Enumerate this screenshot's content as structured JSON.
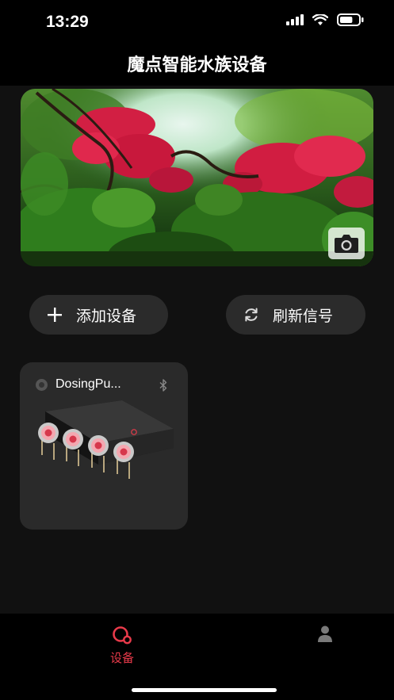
{
  "status_bar": {
    "time": "13:29",
    "battery_level": 0.7
  },
  "header": {
    "title": "魔点智能水族设备"
  },
  "banner": {
    "image": "aquarium-photo",
    "camera_icon": "camera-icon"
  },
  "actions": {
    "add_label": "添加设备",
    "refresh_label": "刷新信号"
  },
  "devices": [
    {
      "name": "DosingPu...",
      "connection_icon": "bluetooth-icon",
      "image": "dosing-pump-4-head"
    }
  ],
  "tabbar": {
    "tabs": [
      {
        "label": "设备",
        "active": true,
        "icon": "devices-icon"
      },
      {
        "label": "",
        "active": false,
        "icon": "profile-icon"
      }
    ]
  },
  "colors": {
    "accent": "#e83a4a",
    "background": "#111111",
    "card": "#2a2a2a",
    "pill": "#2b2b2b"
  }
}
